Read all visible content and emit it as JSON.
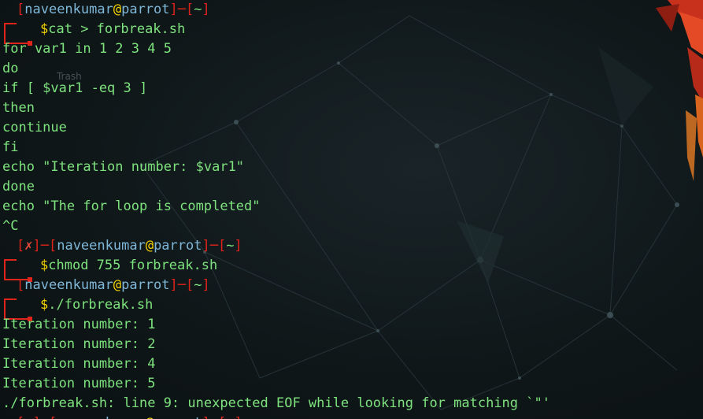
{
  "desktop": {
    "trash_label": "Trash"
  },
  "prompt": {
    "user": "naveenkumar",
    "at": "@",
    "host": "parrot",
    "path": "~",
    "error_mark": "✗"
  },
  "lines": [
    {
      "type": "prompt-top",
      "error": false
    },
    {
      "type": "prompt-cmd",
      "dollar": "$",
      "cmd": "cat > forbreak.sh"
    },
    {
      "type": "text",
      "text": "for var1 in 1 2 3 4 5"
    },
    {
      "type": "text",
      "text": "do"
    },
    {
      "type": "text",
      "text": "if [ $var1 -eq 3 ]"
    },
    {
      "type": "text",
      "text": "then"
    },
    {
      "type": "text",
      "text": "continue"
    },
    {
      "type": "text",
      "text": "fi"
    },
    {
      "type": "text",
      "text": "echo \"Iteration number: $var1\""
    },
    {
      "type": "text",
      "text": "done"
    },
    {
      "type": "text",
      "text": "echo \"The for loop is completed\""
    },
    {
      "type": "text",
      "text": "^C"
    },
    {
      "type": "prompt-top",
      "error": true
    },
    {
      "type": "prompt-cmd",
      "dollar": "$",
      "cmd": "chmod 755 forbreak.sh"
    },
    {
      "type": "prompt-top",
      "error": false
    },
    {
      "type": "prompt-cmd",
      "dollar": "$",
      "cmd": "./forbreak.sh"
    },
    {
      "type": "text",
      "text": "Iteration number: 1"
    },
    {
      "type": "text",
      "text": "Iteration number: 2"
    },
    {
      "type": "text",
      "text": "Iteration number: 4"
    },
    {
      "type": "text",
      "text": "Iteration number: 5"
    },
    {
      "type": "text",
      "text": "./forbreak.sh: line 9: unexpected EOF while looking for matching `\"'"
    },
    {
      "type": "prompt-top",
      "error": true
    }
  ],
  "colors": {
    "text_green": "#7ee37e",
    "prompt_red": "#e0241b",
    "user_blue": "#7fb7d8",
    "at_yellow": "#f5d400"
  }
}
